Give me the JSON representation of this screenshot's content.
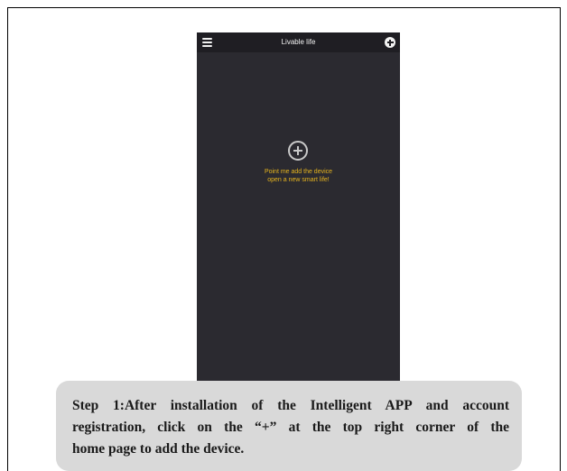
{
  "app": {
    "title": "Livable life",
    "menu_icon": "menu-icon",
    "add_icon": "plus-circle-icon"
  },
  "main": {
    "center_icon": "plus-circle-icon",
    "hint_line1": "Point me add the device",
    "hint_line2": "open a new smart life!"
  },
  "caption": {
    "line1": "Step 1:After installation of the Intelligent APP and account",
    "line2": "registration, click on the “+” at the top right corner of the",
    "line3": "home page to add the device."
  },
  "colors": {
    "phone_background": "#2b2a30",
    "header_background": "#1f1e23",
    "hint_text": "#e6b41e",
    "caption_background": "#d9d9d9"
  }
}
